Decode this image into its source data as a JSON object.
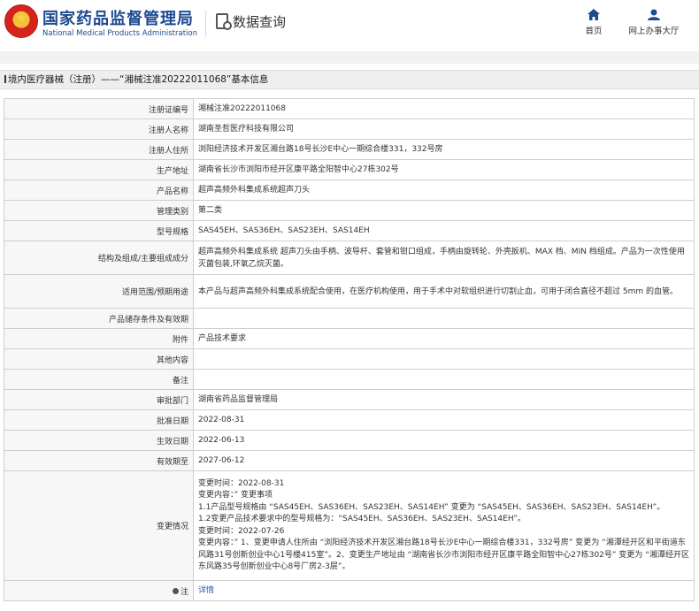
{
  "header": {
    "title": "国家药品监督管理局",
    "subtitle": "National Medical Products Administration",
    "query_title": "数据查询",
    "nav_home": "首页",
    "nav_online": "网上办事大厅"
  },
  "breadcrumb": "境内医疗器械（注册）——“湘械注准20222011068”基本信息",
  "rows": [
    {
      "label": "注册证编号",
      "value": "湘械注准20222011068"
    },
    {
      "label": "注册人名称",
      "value": "湖南圣哲医疗科技有限公司"
    },
    {
      "label": "注册人住所",
      "value": "浏阳经济技术开发区湘台路18号长沙E中心一期综合楼331，332号房"
    },
    {
      "label": "生产地址",
      "value": "湖南省长沙市浏阳市经开区康平路全阳智中心27栋302号"
    },
    {
      "label": "产品名称",
      "value": "超声高频外科集成系统超声刀头"
    },
    {
      "label": "管理类别",
      "value": "第二类"
    },
    {
      "label": "型号规格",
      "value": "SAS45EH、SAS36EH、SAS23EH、SAS14EH"
    },
    {
      "label": "结构及组成/主要组成成分",
      "value": "超声高频外科集成系统 超声刀头由手柄、波导杆、套管和钳口组成，手柄由旋转轮、外壳扳机、MAX 档、MIN 档组成。产品为一次性使用灭菌包装,环氧乙烷灭菌。"
    },
    {
      "label": "适用范围/预期用途",
      "value": "本产品与超声高频外科集成系统配合使用，在医疗机构使用，用于手术中对软组织进行切割止血，可用于闭合直径不超过 5mm 的血管。"
    },
    {
      "label": "产品储存条件及有效期",
      "value": ""
    },
    {
      "label": "附件",
      "value": "产品技术要求"
    },
    {
      "label": "其他内容",
      "value": ""
    },
    {
      "label": "备注",
      "value": ""
    },
    {
      "label": "审批部门",
      "value": "湖南省药品监督管理局"
    },
    {
      "label": "批准日期",
      "value": "2022-08-31"
    },
    {
      "label": "生效日期",
      "value": "2022-06-13"
    },
    {
      "label": "有效期至",
      "value": "2027-06-12"
    }
  ],
  "change": {
    "label": "变更情况",
    "lines": [
      "变更时间：2022-08-31",
      "变更内容：” 变更事项",
      "1.1产品型号规格由 “SAS45EH、SAS36EH、SAS23EH、SAS14EH” 变更为 “SAS45EH、SAS36EH、SAS23EH、SAS14EH”。",
      "1.2变更产品技术要求中的型号规格为：“SAS45EH、SAS36EH、SAS23EH、SAS14EH”。",
      "变更时间：2022-07-26",
      "变更内容：” 1、变更申请人住所由 “浏阳经济技术开发区湘台路18号长沙E中心一期综合楼331，332号房” 变更为 “湘潭经开区和平街道东风路31号创新创业中心1号楼415室”。2、变更生产地址由 “湖南省长沙市浏阳市经开区康平路全阳智中心27栋302号” 变更为 “湘潭经开区东风路35号创新创业中心8号厂房2-3层”。"
    ]
  },
  "note": {
    "label": "注",
    "value": "详情"
  },
  "icons": [
    "emblem-icon",
    "query-icon",
    "home-icon",
    "user-icon",
    "note-icon"
  ],
  "colors": {
    "brand": "#1d4a91",
    "link": "#1f5fb0"
  }
}
